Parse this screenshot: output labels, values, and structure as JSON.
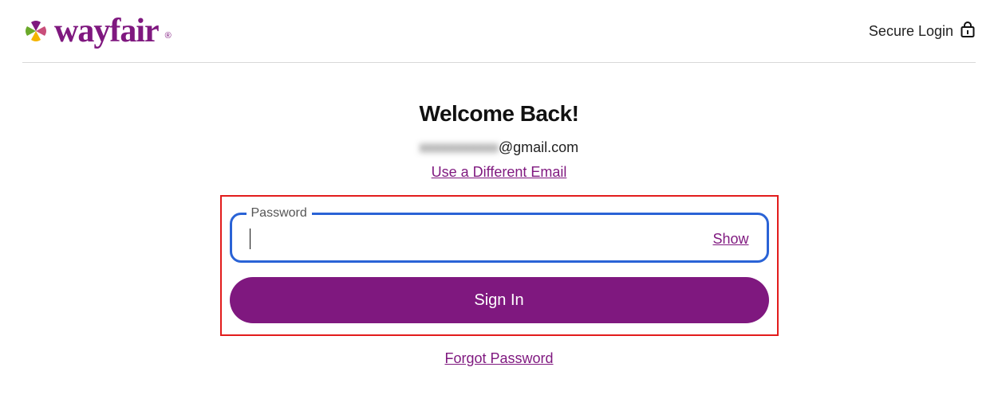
{
  "header": {
    "brand_name": "wayfair",
    "secure_label": "Secure Login"
  },
  "main": {
    "title": "Welcome Back!",
    "email_obscured_part": "xxxxxxxxxxx",
    "email_visible_part": "@gmail.com",
    "change_email_label": "Use a Different Email",
    "password_label": "Password",
    "password_value": "",
    "show_label": "Show",
    "signin_label": "Sign In",
    "forgot_label": "Forgot Password"
  },
  "colors": {
    "brand_purple": "#7f187f",
    "focus_blue": "#2a63d6",
    "highlight_red": "#e21c1c"
  }
}
